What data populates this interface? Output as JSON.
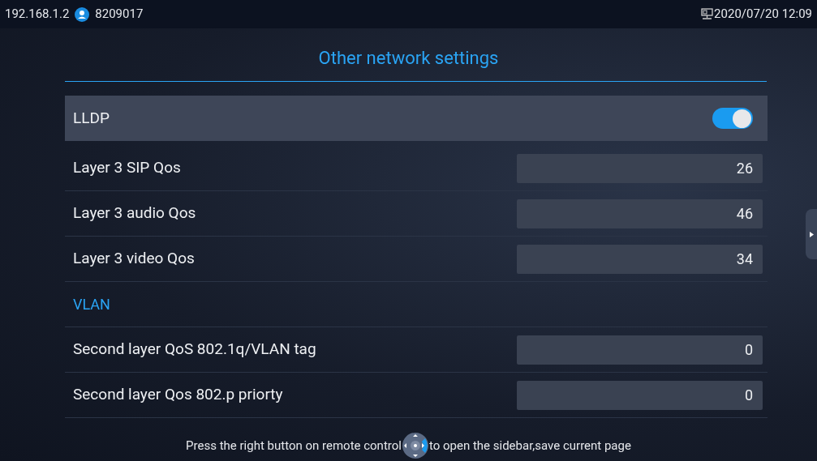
{
  "status_bar": {
    "ip": "192.168.1.2",
    "account": "8209017",
    "datetime": "2020/07/20 12:09"
  },
  "title": "Other network settings",
  "rows": [
    {
      "kind": "toggle",
      "label": "LLDP",
      "on": true,
      "selected": true
    },
    {
      "kind": "input",
      "label": "Layer 3 SIP Qos",
      "value": "26",
      "selected": false
    },
    {
      "kind": "input",
      "label": "Layer 3 audio Qos",
      "value": "46",
      "selected": false
    },
    {
      "kind": "input",
      "label": "Layer 3 video Qos",
      "value": "34",
      "selected": false
    },
    {
      "kind": "section",
      "label": "VLAN"
    },
    {
      "kind": "input",
      "label": "Second layer QoS 802.1q/VLAN tag",
      "value": "0",
      "selected": false
    },
    {
      "kind": "input",
      "label": "Second layer Qos 802.p priorty",
      "value": "0",
      "selected": false
    }
  ],
  "hint": {
    "before": "Press the right button on remote control",
    "after": "to open the sidebar,save current page"
  }
}
